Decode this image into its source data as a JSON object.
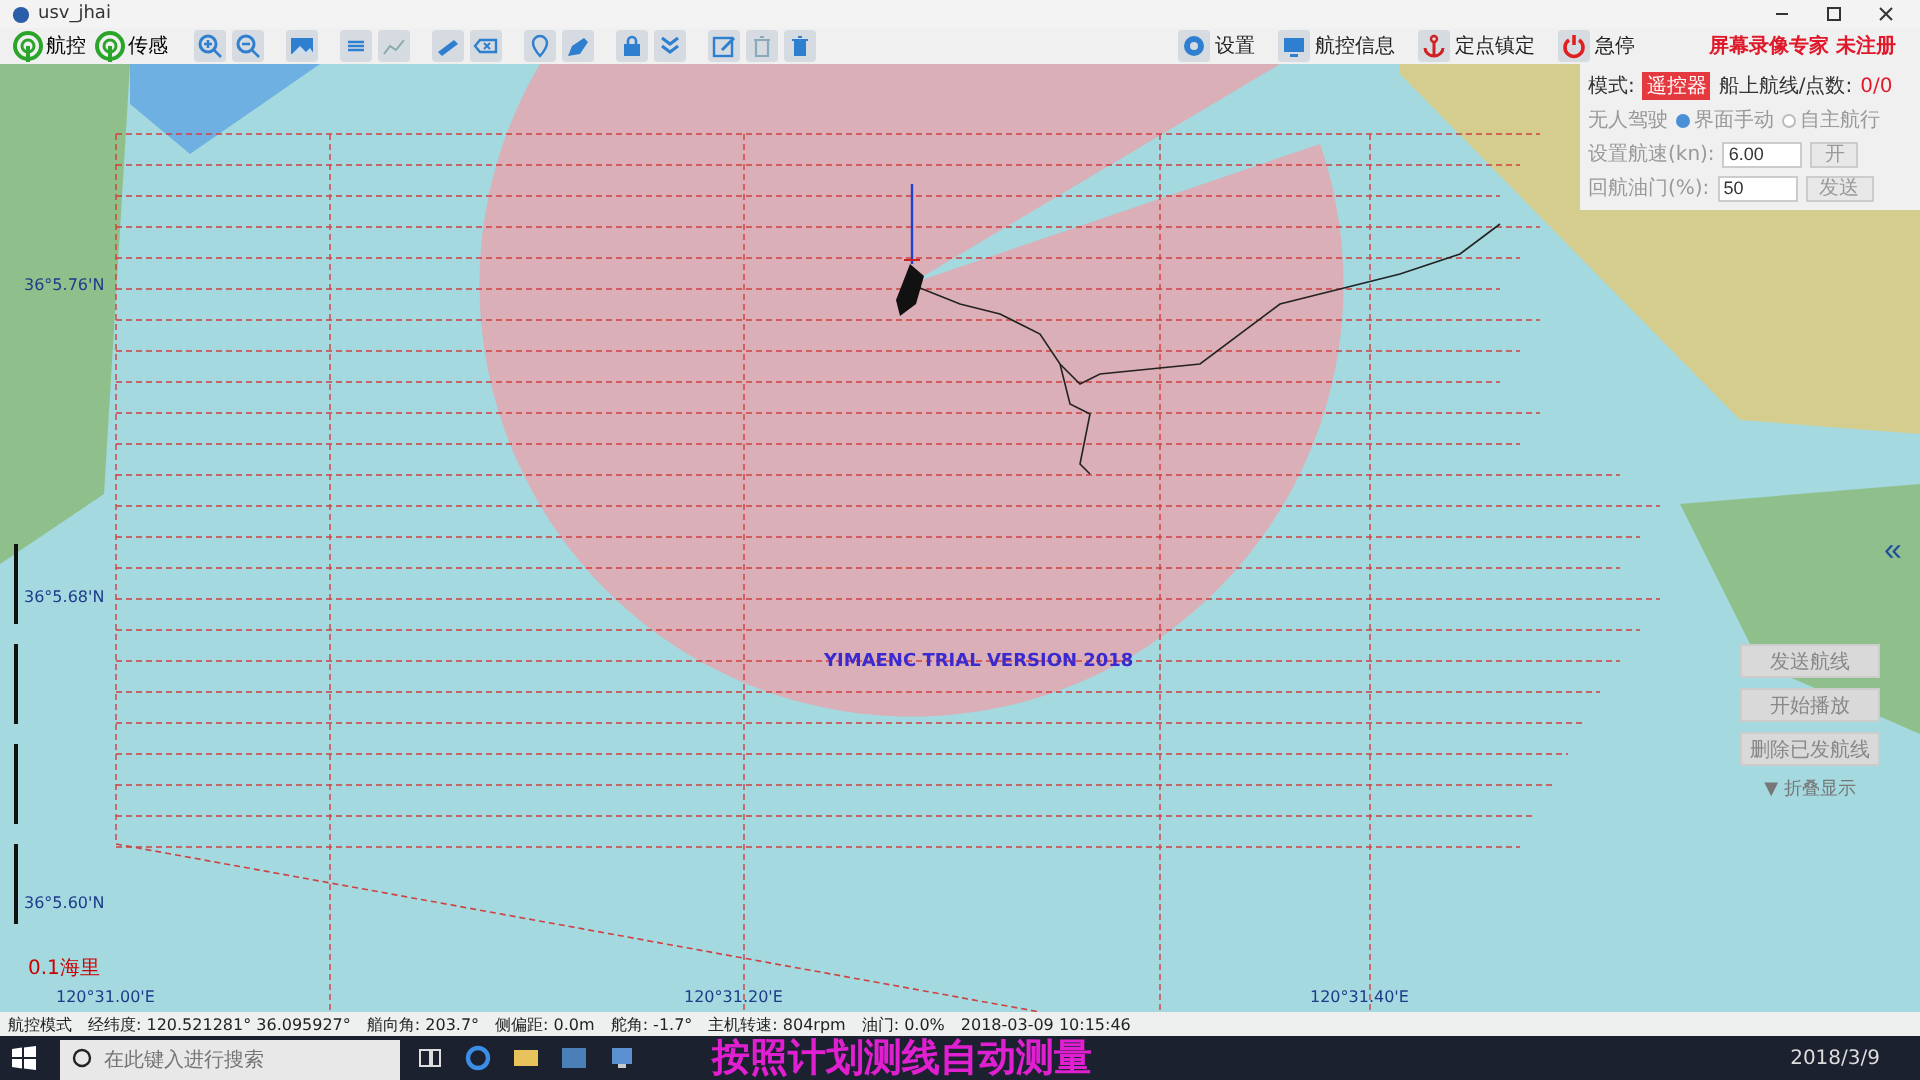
{
  "window": {
    "title": "usv_jhai",
    "recorder_notice": "屏幕录像专家 未注册"
  },
  "toolbar": {
    "left_buttons": [
      {
        "label": "航控"
      },
      {
        "label": "传感"
      }
    ],
    "right_buttons": [
      {
        "label": "设置",
        "kind": "gear"
      },
      {
        "label": "航控信息",
        "kind": "monitor"
      },
      {
        "label": "定点镇定",
        "kind": "anchor"
      },
      {
        "label": "急停",
        "kind": "power"
      }
    ]
  },
  "control_panel": {
    "mode_label": "模式:",
    "mode_value": "遥控器",
    "route_label": "船上航线/点数:",
    "route_value": "0/0",
    "drive_label": "无人驾驶",
    "radios": [
      {
        "label": "界面手动",
        "selected": true
      },
      {
        "label": "自主航行",
        "selected": false
      }
    ],
    "fields": [
      {
        "label": "设置航速(kn):",
        "value": "6.00",
        "button": "开"
      },
      {
        "label": "回航油门(%):",
        "value": "50",
        "button": "发送"
      }
    ]
  },
  "map": {
    "trial_text": "YIMAENC TRIAL VERSION 2018",
    "lat_labels": [
      "36°5.76'N",
      "36°5.68'N",
      "36°5.60'N"
    ],
    "lon_labels": [
      "120°31.00'E",
      "120°31.20'E",
      "120°31.40'E"
    ],
    "scale": "0.1海里",
    "side_toggle": "«"
  },
  "route_buttons": [
    "发送航线",
    "开始播放",
    "删除已发航线"
  ],
  "route_toggle": "▼ 折叠显示",
  "status_bar": [
    {
      "label": "航控模式"
    },
    {
      "label": "经纬度:",
      "value": "120.521281°  36.095927°"
    },
    {
      "label": "艏向角:",
      "value": "203.7°"
    },
    {
      "label": "侧偏距:",
      "value": "0.0m"
    },
    {
      "label": "舵角:",
      "value": "-1.7°"
    },
    {
      "label": "主机转速:",
      "value": "804rpm"
    },
    {
      "label": "油门:",
      "value": "0.0%"
    },
    {
      "value": "2018-03-09 10:15:46"
    }
  ],
  "taskbar": {
    "search_placeholder": "在此键入进行搜索",
    "caption": "按照计划测线自动测量",
    "date": "2018/3/9"
  }
}
